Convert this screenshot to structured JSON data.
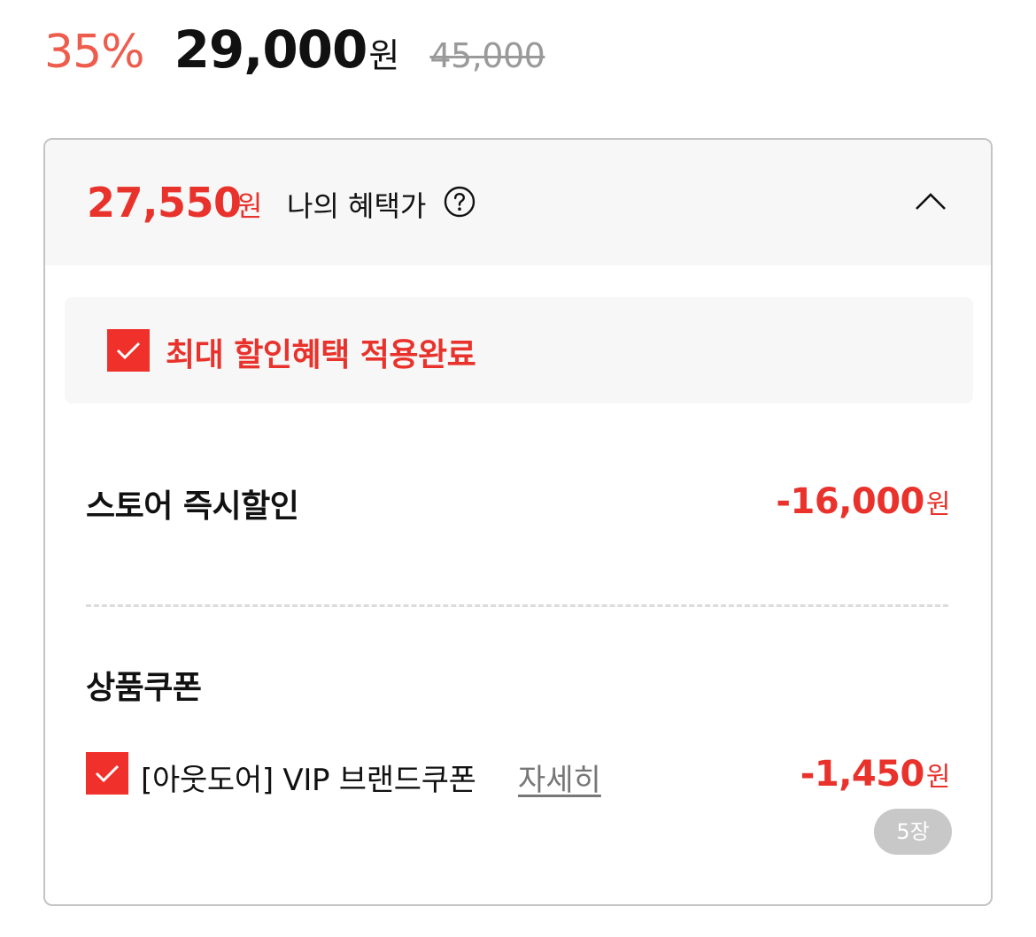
{
  "price": {
    "discount_rate": "35%",
    "sale_price": "29,000",
    "sale_unit": "원",
    "original_price": "45,000"
  },
  "benefit": {
    "my_price": "27,550",
    "my_price_unit": "원",
    "my_price_label": "나의 혜택가",
    "help_icon": "question-circle-icon",
    "toggle_icon": "chevron-up-icon",
    "applied_text": "최대 할인혜택 적용완료",
    "store_discount": {
      "label": "스토어 즉시할인",
      "amount": "-16,000",
      "unit": "원"
    },
    "coupon": {
      "title": "상품쿠폰",
      "name": "[아웃도어] VIP 브랜드쿠폰",
      "detail_link": "자세히",
      "amount": "-1,450",
      "unit": "원",
      "count_badge": "5장",
      "checked": true
    }
  },
  "colors": {
    "accent_red": "#e8322b",
    "discount_orange": "#ee5c4d",
    "checkbox_red": "#f0302a",
    "muted_gray": "#9a9a9a",
    "panel_bg": "#f7f7f7"
  }
}
